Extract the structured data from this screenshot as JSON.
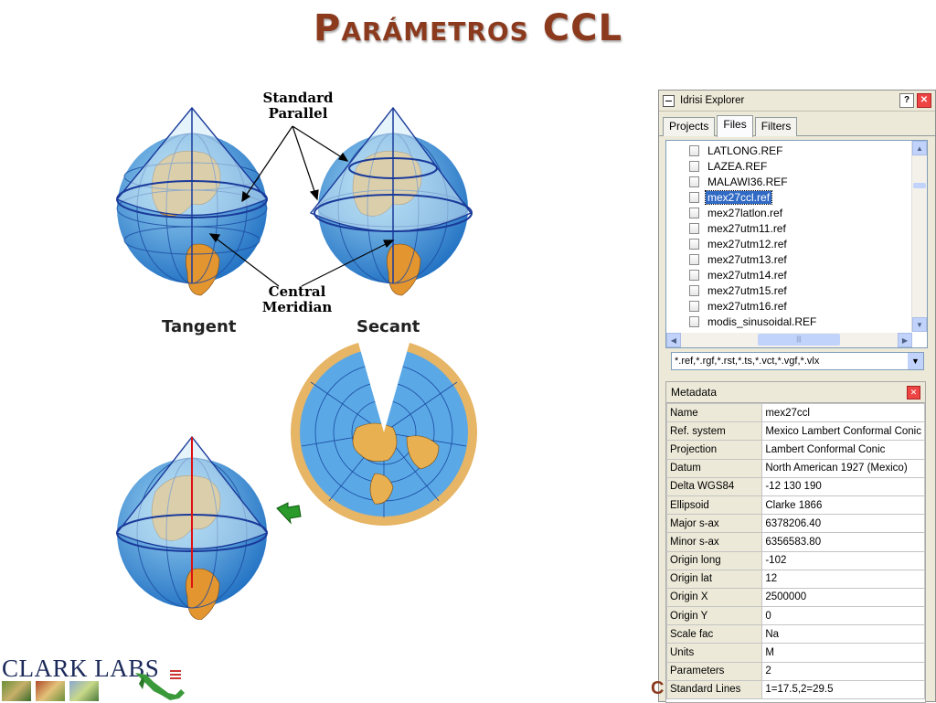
{
  "slide": {
    "title_initial": "P",
    "title_rest": "arámetros",
    "title_tail": "CCL"
  },
  "illustration": {
    "standard_parallel_label": [
      "Standard",
      "Parallel"
    ],
    "central_meridian_label": [
      "Central",
      "Meridian"
    ],
    "tangent_label": "Tangent",
    "secant_label": "Secant"
  },
  "explorer": {
    "title": "Idrisi Explorer",
    "help_icon": "question-icon",
    "close_icon": "close-icon",
    "tabs": [
      {
        "label": "Projects",
        "active": false
      },
      {
        "label": "Files",
        "active": true
      },
      {
        "label": "Filters",
        "active": false
      }
    ],
    "files": [
      {
        "name": "LATLONG.REF",
        "selected": false
      },
      {
        "name": "LAZEA.REF",
        "selected": false
      },
      {
        "name": "MALAWI36.REF",
        "selected": false
      },
      {
        "name": "mex27ccl.ref",
        "selected": true
      },
      {
        "name": "mex27latlon.ref",
        "selected": false
      },
      {
        "name": "mex27utm11.ref",
        "selected": false
      },
      {
        "name": "mex27utm12.ref",
        "selected": false
      },
      {
        "name": "mex27utm13.ref",
        "selected": false
      },
      {
        "name": "mex27utm14.ref",
        "selected": false
      },
      {
        "name": "mex27utm15.ref",
        "selected": false
      },
      {
        "name": "mex27utm16.ref",
        "selected": false
      },
      {
        "name": "modis_sinusoidal.REF",
        "selected": false
      }
    ],
    "filter_value": "*.ref,*.rgf,*.rst,*.ts,*.vct,*.vgf,*.vlx",
    "metadata": {
      "title": "Metadata",
      "rows": [
        {
          "key": "Name",
          "value": "mex27ccl"
        },
        {
          "key": "Ref. system",
          "value": "Mexico Lambert Conformal Conic"
        },
        {
          "key": "Projection",
          "value": "Lambert Conformal Conic"
        },
        {
          "key": "Datum",
          "value": "North American 1927 (Mexico)"
        },
        {
          "key": "Delta WGS84",
          "value": "-12 130 190"
        },
        {
          "key": "Ellipsoid",
          "value": "Clarke 1866"
        },
        {
          "key": "Major s-ax",
          "value": "6378206.40"
        },
        {
          "key": "Minor s-ax",
          "value": "6356583.80"
        },
        {
          "key": "Origin long",
          "value": "-102"
        },
        {
          "key": "Origin lat",
          "value": "12"
        },
        {
          "key": "Origin X",
          "value": "2500000"
        },
        {
          "key": "Origin Y",
          "value": "0"
        },
        {
          "key": "Scale fac",
          "value": "Na"
        },
        {
          "key": "Units",
          "value": "M"
        },
        {
          "key": "Parameters",
          "value": "2"
        },
        {
          "key": "Standard Lines",
          "value": "1=17.5,2=29.5"
        }
      ]
    }
  },
  "footer": {
    "logo_text": "CLARK LABS",
    "cut_letter": "C"
  }
}
